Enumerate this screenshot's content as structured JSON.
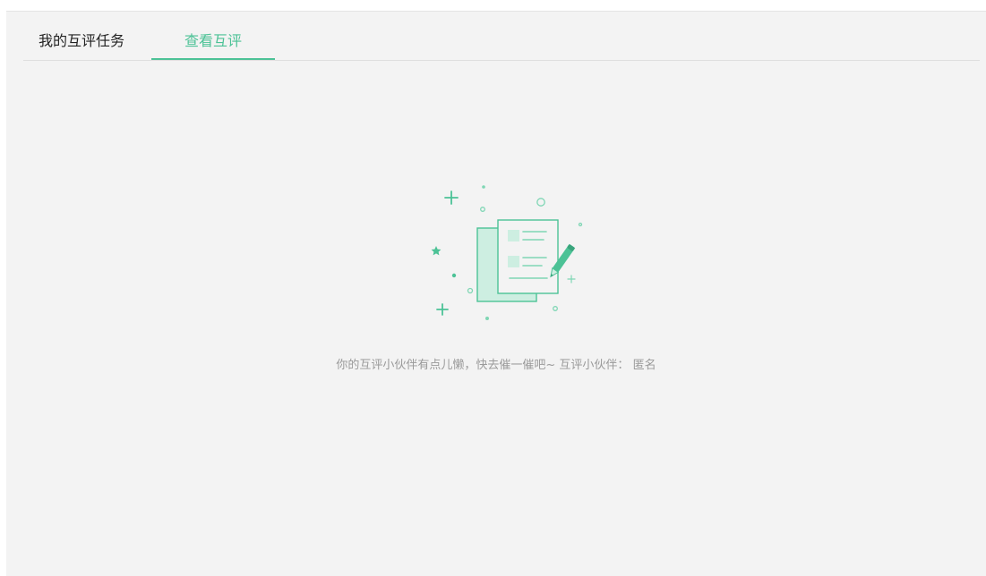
{
  "tabs": [
    {
      "label": "我的互评任务",
      "active": false
    },
    {
      "label": "查看互评",
      "active": true
    }
  ],
  "empty_state": {
    "icon": "document-edit-illustration",
    "message": "你的互评小伙伴有点儿懒，快去催一催吧~ 互评小伙伴： 匿名"
  },
  "colors": {
    "accent": "#4cc296",
    "panel_bg": "#f3f3f3",
    "light_fill": "#cdeee1",
    "muted_text": "#9a9a9a"
  }
}
